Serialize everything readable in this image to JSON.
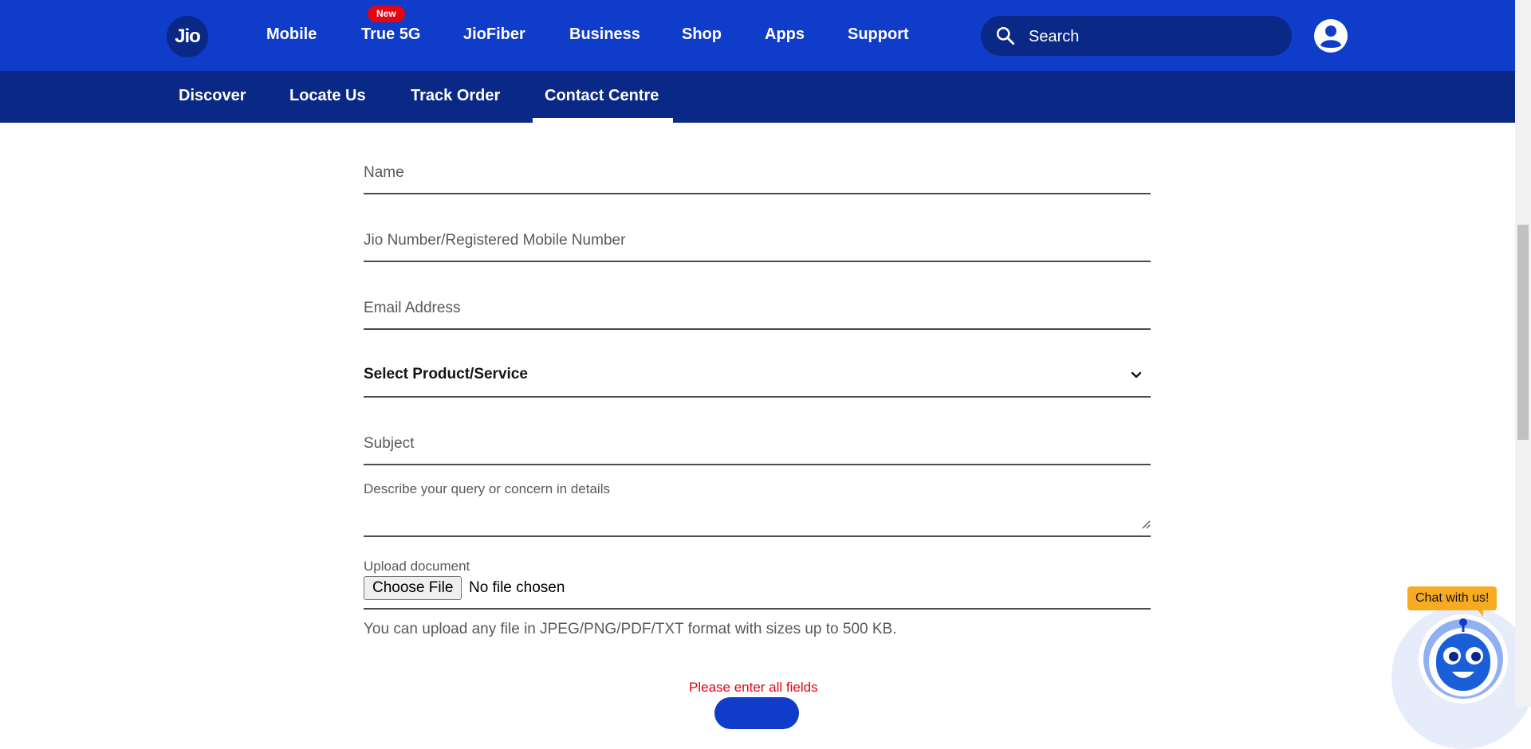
{
  "header": {
    "logo_text": "Jio",
    "nav": [
      {
        "label": "Mobile"
      },
      {
        "label": "True 5G",
        "badge": "New"
      },
      {
        "label": "JioFiber"
      },
      {
        "label": "Business"
      },
      {
        "label": "Shop"
      },
      {
        "label": "Apps"
      },
      {
        "label": "Support"
      }
    ],
    "search": {
      "placeholder": "Search",
      "icon": "search-icon"
    },
    "profile_icon": "user-icon"
  },
  "subnav": {
    "items": [
      {
        "label": "Discover"
      },
      {
        "label": "Locate Us"
      },
      {
        "label": "Track Order"
      },
      {
        "label": "Contact Centre",
        "active": true
      }
    ]
  },
  "form": {
    "name_placeholder": "Name",
    "number_placeholder": "Jio Number/Registered Mobile Number",
    "email_placeholder": "Email Address",
    "product_select": "Select Product/Service",
    "subject_placeholder": "Subject",
    "description_label": "Describe your query or concern in details",
    "upload_label": "Upload document",
    "choose_file_label": "Choose File",
    "file_status": "No file chosen",
    "upload_helper": "You can upload any file in JPEG/PNG/PDF/TXT format with sizes up to 500 KB.",
    "error_message": "Please enter all fields"
  },
  "chat": {
    "label": "Chat with us!"
  },
  "colors": {
    "primary": "#0f3cc9",
    "primary_dark": "#0a2885",
    "error": "#e30513",
    "chat_badge": "#f7ab20"
  }
}
